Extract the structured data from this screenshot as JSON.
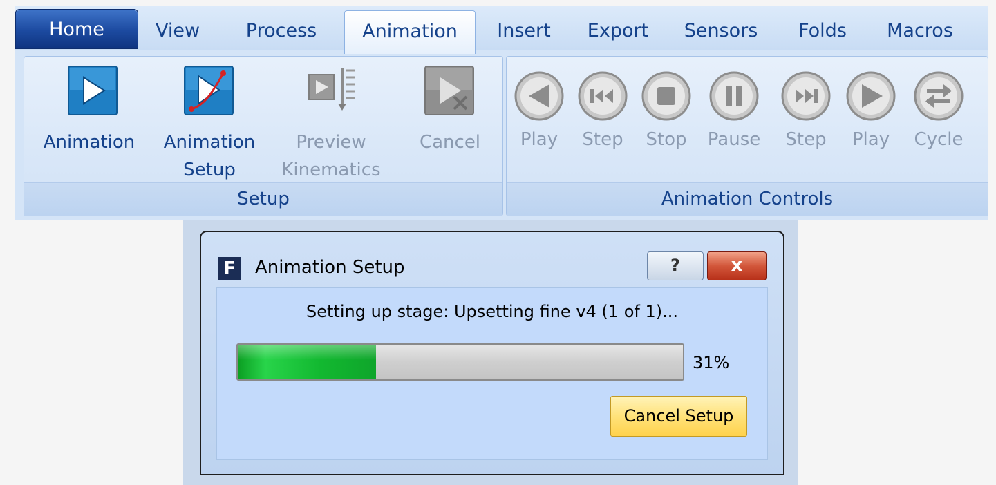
{
  "ribbon": {
    "tabs": [
      "Home",
      "View",
      "Process",
      "Animation",
      "Insert",
      "Export",
      "Sensors",
      "Folds",
      "Macros"
    ],
    "active_tab": "Animation",
    "setup_group": {
      "title": "Setup",
      "buttons": [
        {
          "line1": "Animation",
          "line2": "",
          "enabled": true,
          "icon": "play-icon"
        },
        {
          "line1": "Animation",
          "line2": "Setup",
          "enabled": true,
          "icon": "animation-setup-icon"
        },
        {
          "line1": "Preview",
          "line2": "Kinematics",
          "enabled": false,
          "icon": "preview-kinematics-icon"
        },
        {
          "line1": "Cancel",
          "line2": "",
          "enabled": false,
          "icon": "cancel-icon"
        }
      ]
    },
    "controls_group": {
      "title": "Animation Controls",
      "buttons": [
        {
          "label": "Play",
          "icon": "play-reverse-icon"
        },
        {
          "label": "Step",
          "icon": "step-back-icon"
        },
        {
          "label": "Stop",
          "icon": "stop-icon"
        },
        {
          "label": "Pause",
          "icon": "pause-icon"
        },
        {
          "label": "Step",
          "icon": "step-forward-icon"
        },
        {
          "label": "Play",
          "icon": "play-forward-icon"
        },
        {
          "label": "Cycle",
          "icon": "cycle-icon"
        }
      ]
    }
  },
  "dialog": {
    "app_icon": "F",
    "title": "Animation Setup",
    "help_label": "?",
    "close_label": "x",
    "status": "Setting up stage: Upsetting fine v4 (1 of 1)...",
    "progress": 0.31,
    "progress_text": "31%",
    "cancel_label": "Cancel Setup"
  }
}
